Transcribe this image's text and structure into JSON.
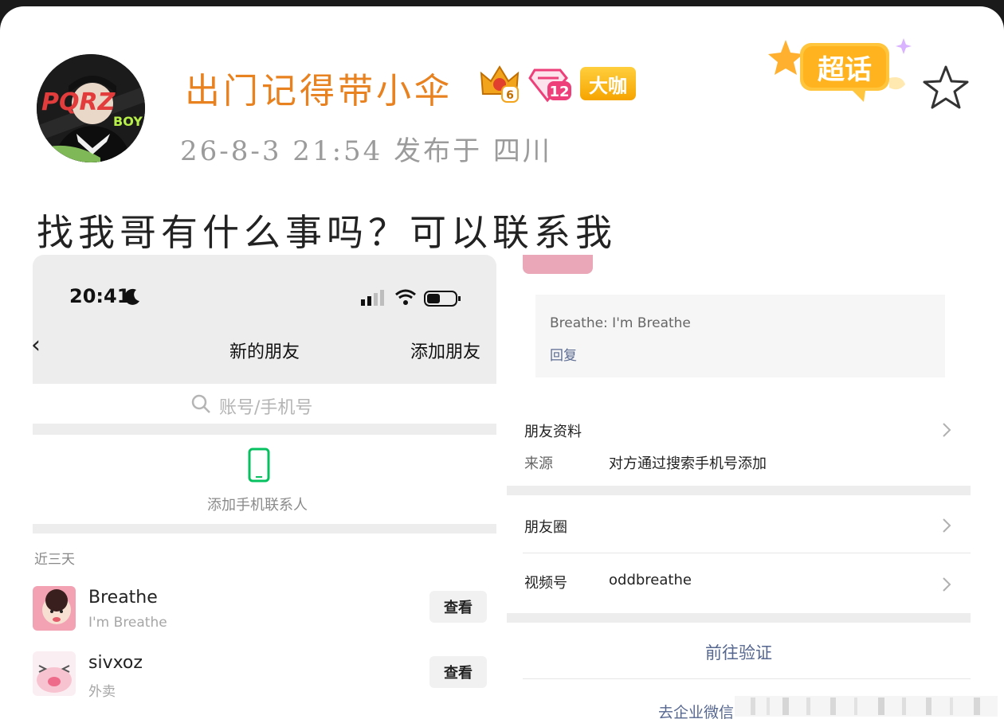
{
  "post": {
    "username": "出门记得带小伞",
    "level_badge": "6",
    "diamond_badge": "12",
    "title_badge": "大咖",
    "meta": "26-8-3 21:54  发布于 四川",
    "supertopic_label": "超话",
    "text": "找我哥有什么事吗？可以联系我",
    "avatar_text": "BOY"
  },
  "left_shot": {
    "time": "20:41",
    "back_icon": "chevron-left-icon",
    "title": "新的朋友",
    "add_friend": "添加朋友",
    "search_placeholder": "账号/手机号",
    "add_contacts_label": "添加手机联系人",
    "section_label": "近三天",
    "friends": [
      {
        "name": "Breathe",
        "sub": "I'm Breathe",
        "button": "查看"
      },
      {
        "name": "sivxoz",
        "sub": "外卖",
        "button": "查看"
      }
    ]
  },
  "right_shot": {
    "message": "Breathe: I'm Breathe",
    "reply": "回复",
    "profile_label": "朋友资料",
    "source_label": "来源",
    "source_value": "对方通过搜索手机号添加",
    "moments_label": "朋友圈",
    "channels_label": "视频号",
    "channels_value": "oddbreathe",
    "verify_button": "前往验证",
    "wecom_link": "去企业微信"
  },
  "colors": {
    "username": "#e8811f",
    "link_blue": "#55668f",
    "badge_gold": "#f6a400",
    "wechat_green": "#07c160"
  }
}
